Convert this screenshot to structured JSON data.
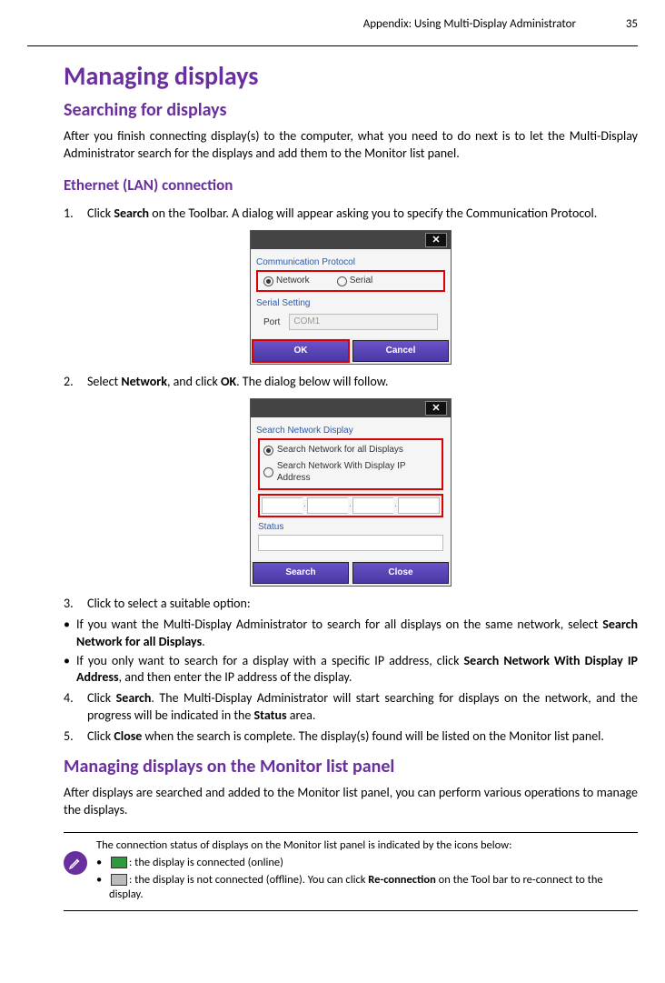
{
  "header": {
    "section": "Appendix: Using Multi-Display Administrator",
    "page": "35"
  },
  "h1": "Managing displays",
  "h2a": "Searching for displays",
  "intro": "After you finish connecting display(s) to the computer, what you need to do next is to let the Multi-Display Administrator search for the displays and add them to the Monitor list panel.",
  "h3a": "Ethernet (LAN) connection",
  "step1": {
    "num": "1.",
    "pre": "Click ",
    "bold": "Search",
    "post": " on the Toolbar. A dialog will appear asking you to specify the Communication Protocol."
  },
  "dlg1": {
    "close": "✕",
    "grp1": "Communication Protocol",
    "r1a": "Network",
    "r1b": "Serial",
    "grp2": "Serial Setting",
    "portLbl": "Port",
    "portVal": "COM1",
    "ok": "OK",
    "cancel": "Cancel"
  },
  "step2": {
    "num": "2.",
    "pre": "Select ",
    "b1": "Network",
    "mid": ", and click ",
    "b2": "OK",
    "post": ". The dialog below will follow."
  },
  "dlg2": {
    "close": "✕",
    "grp1": "Search Network Display",
    "opt1": "Search Network for all Displays",
    "opt2": "Search Network With Display IP Address",
    "statusLbl": "Status",
    "search": "Search",
    "closeBtn": "Close"
  },
  "step3": {
    "num": "3.",
    "text": "Click to select a suitable option:"
  },
  "bulA": {
    "pre": "If you want the Multi-Display Administrator to search for all displays on the same network, select ",
    "b": "Search Network for all Displays",
    "post": "."
  },
  "bulB": {
    "pre": "If you only want to search for a display with a specific IP address, click ",
    "b": "Search Network With Display IP Address",
    "post": ", and then enter the IP address of the display."
  },
  "step4": {
    "num": "4.",
    "pre": "Click ",
    "b1": "Search",
    "mid": ". The Multi-Display Administrator will start searching for displays on the network, and the progress will be indicated in the ",
    "b2": "Status",
    "post": " area."
  },
  "step5": {
    "num": "5.",
    "pre": "Click ",
    "b1": "Close",
    "post": " when the search is complete. The display(s) found will be listed on the Monitor list panel."
  },
  "h2b": "Managing displays on the Monitor list panel",
  "para2": "After displays are searched and added to the Monitor list panel, you can perform various operations to manage the displays.",
  "note": {
    "line1": "The connection status of displays on the Monitor list panel is indicated by the icons below:",
    "on": ": the display is connected (online)",
    "off_pre": ": the display is not connected (offline). You can click ",
    "off_b": "Re-connection",
    "off_post": " on the Tool bar to re-connect to the display."
  }
}
